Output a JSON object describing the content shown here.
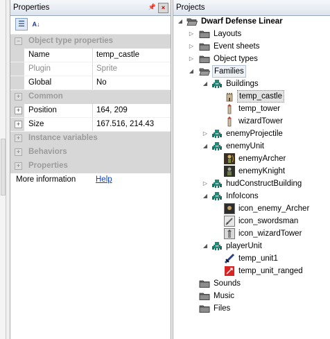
{
  "properties": {
    "title": "Properties",
    "rows": [
      {
        "kind": "cat",
        "label": "Object type properties",
        "expander": "−"
      },
      {
        "kind": "prop",
        "name": "Name",
        "value": "temp_castle",
        "dim": false
      },
      {
        "kind": "prop",
        "name": "Plugin",
        "value": "Sprite",
        "dim": true
      },
      {
        "kind": "prop",
        "name": "Global",
        "value": "No",
        "dim": false
      },
      {
        "kind": "cat",
        "label": "Common",
        "expander": "+"
      },
      {
        "kind": "prop",
        "name": "Position",
        "value": "164, 209",
        "dim": false,
        "expander": "+"
      },
      {
        "kind": "prop",
        "name": "Size",
        "value": "167.516, 214.43",
        "dim": false,
        "expander": "+"
      },
      {
        "kind": "cat",
        "label": "Instance variables",
        "expander": "+"
      },
      {
        "kind": "cat",
        "label": "Behaviors",
        "expander": "+"
      },
      {
        "kind": "cat",
        "label": "Properties",
        "expander": "+"
      }
    ],
    "more_label": "More information",
    "help_link": "Help"
  },
  "projects": {
    "title": "Projects",
    "tree": [
      {
        "label": "Dwarf Defense Linear",
        "depth": 0,
        "toggle": "open",
        "icon": "folder-open",
        "bold": true
      },
      {
        "label": "Layouts",
        "depth": 1,
        "toggle": "closed",
        "icon": "folder"
      },
      {
        "label": "Event sheets",
        "depth": 1,
        "toggle": "closed",
        "icon": "folder"
      },
      {
        "label": "Object types",
        "depth": 1,
        "toggle": "closed",
        "icon": "folder"
      },
      {
        "label": "Families",
        "depth": 1,
        "toggle": "open",
        "icon": "folder-open",
        "style": "fam"
      },
      {
        "label": "Buildings",
        "depth": 2,
        "toggle": "open",
        "icon": "family"
      },
      {
        "label": "temp_castle",
        "depth": 3,
        "toggle": "none",
        "icon": "castle",
        "style": "selected"
      },
      {
        "label": "temp_tower",
        "depth": 3,
        "toggle": "none",
        "icon": "tower"
      },
      {
        "label": "wizardTower",
        "depth": 3,
        "toggle": "none",
        "icon": "tower"
      },
      {
        "label": "enemyProjectile",
        "depth": 2,
        "toggle": "closed",
        "icon": "family"
      },
      {
        "label": "enemyUnit",
        "depth": 2,
        "toggle": "open",
        "icon": "family"
      },
      {
        "label": "enemyArcher",
        "depth": 3,
        "toggle": "none",
        "icon": "archer"
      },
      {
        "label": "enemyKnight",
        "depth": 3,
        "toggle": "none",
        "icon": "knight"
      },
      {
        "label": "hudConstructBuilding",
        "depth": 2,
        "toggle": "closed",
        "icon": "family"
      },
      {
        "label": "InfoIcons",
        "depth": 2,
        "toggle": "open",
        "icon": "family"
      },
      {
        "label": "icon_enemy_Archer",
        "depth": 3,
        "toggle": "none",
        "icon": "icon-archer"
      },
      {
        "label": "icon_swordsman",
        "depth": 3,
        "toggle": "none",
        "icon": "icon-sword"
      },
      {
        "label": "icon_wizardTower",
        "depth": 3,
        "toggle": "none",
        "icon": "icon-wizard"
      },
      {
        "label": "playerUnit",
        "depth": 2,
        "toggle": "open",
        "icon": "family"
      },
      {
        "label": "temp_unit1",
        "depth": 3,
        "toggle": "none",
        "icon": "unit1"
      },
      {
        "label": "temp_unit_ranged",
        "depth": 3,
        "toggle": "none",
        "icon": "unit-ranged"
      },
      {
        "label": "Sounds",
        "depth": 1,
        "toggle": "none",
        "icon": "folder"
      },
      {
        "label": "Music",
        "depth": 1,
        "toggle": "none",
        "icon": "folder"
      },
      {
        "label": "Files",
        "depth": 1,
        "toggle": "none",
        "icon": "folder"
      }
    ]
  },
  "colors": {
    "accent": "#1b3c85",
    "family_icon": "#1f8a78",
    "folder": "#5a5a5a",
    "link": "#0b3fd1"
  }
}
